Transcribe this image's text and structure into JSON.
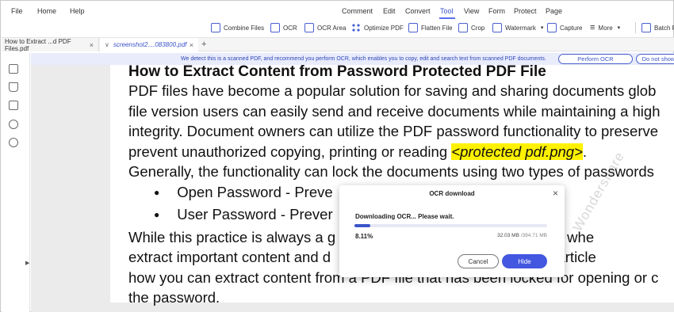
{
  "menu": {
    "left": [
      "File",
      "Home",
      "Help"
    ],
    "tabs": [
      "Comment",
      "Edit",
      "Convert",
      "Tool",
      "View",
      "Form",
      "Protect",
      "Page"
    ],
    "active_tab": "Tool"
  },
  "toolbar": {
    "combine": "Combine Files",
    "ocr": "OCR",
    "ocr_area": "OCR Area",
    "optimize": "Optimize PDF",
    "flatten": "Flatten File",
    "crop": "Crop",
    "watermark": "Watermark",
    "capture": "Capture",
    "more": "More",
    "batch": "Batch P"
  },
  "tabs": {
    "tab1": "How to Extract ...d PDF Files.pdf",
    "tab2": "screenshot2....083800.pdf",
    "new": "+"
  },
  "banner": {
    "text": "We detect this is a scanned PDF, and recommend you perform OCR, which enables you to copy, edit and search text from scanned PDF documents.",
    "perform": "Perform OCR",
    "dismiss": "Do not show"
  },
  "document": {
    "title": "How to Extract Content from Password Protected PDF File",
    "line1": "PDF files have become a popular solution for saving and sharing documents glob",
    "line2": "file version users can easily send and receive documents while maintaining a high",
    "line3": "integrity. Document owners can utilize the PDF password functionality to preserve",
    "line4_pre": "prevent unauthorized copying, printing or reading ",
    "line4_hl": "<protected pdf.png>",
    "line4_post": ".",
    "line5": "Generally, the functionality can lock the documents using two types of passwords",
    "bullet1": "Open Password - Preve",
    "bullet2": "User Password - Prever                                            ent",
    "line6": "While this practice is always a g                                     a headache whe",
    "line7": "extract important content and d                                      word. This article",
    "line8": "how you can extract content from a PDF file that has been locked for opening or c",
    "line9": "the password."
  },
  "dialog": {
    "title": "OCR download",
    "status": "Downloading OCR... Please wait.",
    "percent": "8.11%",
    "progress": 0.0811,
    "downloaded": "32.03 MB",
    "total": " /394.71 MB",
    "cancel": "Cancel",
    "hide": "Hide"
  },
  "colors": {
    "accent": "#4357e0",
    "highlight": "#fff200"
  }
}
